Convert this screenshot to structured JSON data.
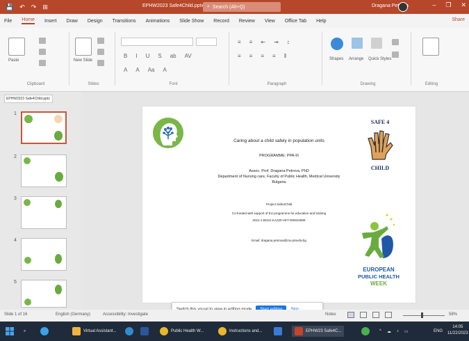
{
  "titlebar": {
    "qa_save": "💾",
    "qa_undo": "↶",
    "qa_redo": "↷",
    "qa_present": "⊞",
    "document_name": "EPHW2023 Safe4Child.pptx - PowerPoint",
    "search_placeholder": "Search (Alt+Q)",
    "user_name": "Dragana Petrova",
    "minimize": "–",
    "restore": "❐",
    "close": "✕"
  },
  "tabs": [
    {
      "label": "File"
    },
    {
      "label": "Home"
    },
    {
      "label": "Insert"
    },
    {
      "label": "Draw"
    },
    {
      "label": "Design"
    },
    {
      "label": "Transitions"
    },
    {
      "label": "Animations"
    },
    {
      "label": "Slide Show"
    },
    {
      "label": "Record"
    },
    {
      "label": "Review"
    },
    {
      "label": "View"
    },
    {
      "label": "Office Tab"
    },
    {
      "label": "Help"
    }
  ],
  "share_label": "Share",
  "ribbon": {
    "clipboard": {
      "paste": "Paste",
      "label": "Clipboard"
    },
    "slides": {
      "new_slide": "New Slide",
      "label": "Slides"
    },
    "font": {
      "label": "Font"
    },
    "paragraph": {
      "label": "Paragraph"
    },
    "drawing": {
      "shapes": "Shapes",
      "arrange": "Arrange",
      "quick_styles": "Quick Styles",
      "label": "Drawing"
    },
    "editing": {
      "label": "Editing"
    }
  },
  "thumbpane": {
    "tab_label": "EPHW2023 Safe4Child.pptx"
  },
  "slide_numbers": [
    "1",
    "2",
    "3",
    "4",
    "5"
  ],
  "slide": {
    "line1": "Caring about a child safely in population units",
    "line2": "PROGRAMME: PPA-III",
    "line3": "Assoc. Prof. Dragana Petrova, PhD",
    "line4": "Department of Nursing care, Faculty of Public Health, Medical University",
    "line5": "Bulgaria",
    "line6": "Project Safe4Child",
    "line7": "Co-funded with support of EU programme for education and training",
    "line8": "2021-1-BG01-KA220-VET-000034909",
    "line9": "Email: dragana.petrova@mu-plovdiv.bg",
    "safe_text": "SAFE 4",
    "child_text": "CHILD",
    "ephw_line1": "EUROPEAN",
    "ephw_line2": "PUBLIC HEALTH",
    "ephw_line3": "WEEK"
  },
  "statusbar": {
    "slide_count": "Slide 1 of 16",
    "language": "English (Germany)",
    "accessibility": "Accessibility: Investigate",
    "notes": "Notes",
    "zoom": "58%"
  },
  "notification": {
    "text": "Switch this visual to view in editing mode",
    "primary": "Start editing",
    "secondary": "Skip"
  },
  "taskbar": {
    "app1": "Virtual Assistant...",
    "app2": "Public Health W...",
    "app3": "Instructions and...",
    "app4": "EPHW23 Safe4C...",
    "lang": "ENG",
    "time": "14:05",
    "date": "11/22/2023"
  },
  "colors": {
    "accent": "#b7472a",
    "taskbar": "#1f2b3a"
  }
}
